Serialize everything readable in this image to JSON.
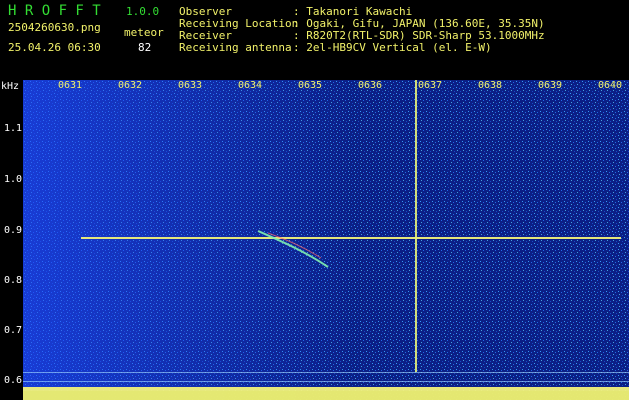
{
  "header": {
    "app_name": "H R O F F T",
    "version": "1.0.0",
    "filename": "2504260630.png",
    "datetime": "25.04.26 06:30",
    "meteor_label": "meteor",
    "meteor_count": "82",
    "fields": [
      {
        "label": "Observer",
        "value": ": Takanori Kawachi"
      },
      {
        "label": "Receiving Location",
        "value": ": Ogaki, Gifu, JAPAN (136.60E, 35.35N)"
      },
      {
        "label": "Receiver",
        "value": ": R820T2(RTL-SDR) SDR-Sharp 53.1000MHz"
      },
      {
        "label": "Receiving antenna",
        "value": ": 2el-HB9CV Vertical (el. E-W)"
      }
    ]
  },
  "axis": {
    "y_unit": "kHz",
    "y_ticks": [
      "1.1",
      "1.0",
      "0.9",
      "0.8",
      "0.7",
      "0.6"
    ],
    "x_ticks": [
      "0631",
      "0632",
      "0633",
      "0634",
      "0635",
      "0636",
      "0637",
      "0638",
      "0639",
      "0640"
    ]
  },
  "colors": {
    "background": "#0b1f86",
    "noise_cyan": "#3aa6ff",
    "trace_yellow": "#f0f07a"
  }
}
